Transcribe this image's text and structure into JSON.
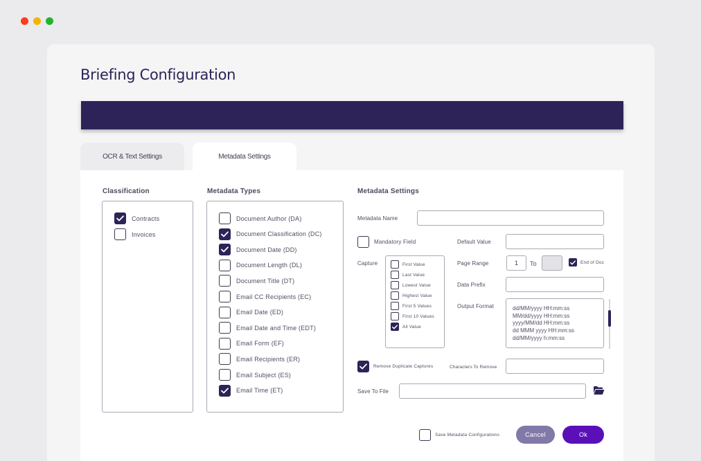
{
  "colors": {
    "accent": "#2e2358",
    "ok_button": "#5a0fb8",
    "cancel_button": "#8279a8",
    "dot_red": "#ff3b1f",
    "dot_yellow": "#f5b400",
    "dot_green": "#22b32c"
  },
  "page": {
    "title": "Briefing Configuration"
  },
  "tabs": [
    {
      "label": "OCR & Text Settings",
      "active": false
    },
    {
      "label": "Metadata Settings",
      "active": true
    }
  ],
  "classification": {
    "title": "Classification",
    "items": [
      {
        "label": "Contracts",
        "checked": true
      },
      {
        "label": "Invoices",
        "checked": false
      }
    ]
  },
  "metadata_types": {
    "title": "Metadata Types",
    "items": [
      {
        "label": "Document Author (DA)",
        "checked": false
      },
      {
        "label": "Document Classification (DC)",
        "checked": true
      },
      {
        "label": "Document Date (DD)",
        "checked": true
      },
      {
        "label": "Document Length (DL)",
        "checked": false
      },
      {
        "label": "Document Title (DT)",
        "checked": false
      },
      {
        "label": "Email CC Recipients (EC)",
        "checked": false
      },
      {
        "label": "Email Date (ED)",
        "checked": false
      },
      {
        "label": "Email Date and Time (EDT)",
        "checked": false
      },
      {
        "label": "Email Form (EF)",
        "checked": false
      },
      {
        "label": "Email Recipients (ER)",
        "checked": false
      },
      {
        "label": "Email Subject (ES)",
        "checked": false
      },
      {
        "label": "Email Time (ET)",
        "checked": true
      }
    ]
  },
  "metadata_settings": {
    "title": "Metadata Settings",
    "name_label": "Metadata Name",
    "name_value": "",
    "mandatory_label": "Mandatory Field",
    "mandatory_checked": false,
    "default_value_label": "Default Value",
    "default_value": "",
    "capture_label": "Capture",
    "capture_options": [
      {
        "label": "First Value",
        "checked": false
      },
      {
        "label": "Last Value",
        "checked": false
      },
      {
        "label": "Lowest Value",
        "checked": false
      },
      {
        "label": "Highest Value",
        "checked": false
      },
      {
        "label": "First 5 Values",
        "checked": false
      },
      {
        "label": "First 10 Values",
        "checked": false
      },
      {
        "label": "All Value",
        "checked": true
      }
    ],
    "page_range_label": "Page Range",
    "page_range_from": "1",
    "page_range_to_label": "To",
    "page_range_to": "",
    "end_of_doc_label": "End of Doc",
    "end_of_doc_checked": true,
    "data_prefix_label": "Data Prefix",
    "data_prefix": "",
    "output_format_label": "Output Format",
    "output_formats": [
      "dd/MM/yyyy HH:mm:ss",
      "MM/dd/yyyy HH:mm:ss",
      "yyyy/MM/dd HH:mm:ss",
      "dd MMM yyyy HH:mm:ss",
      "dd/MM/yyyy h:mm:ss"
    ],
    "remove_duplicates_label": "Remove Duplicate Captures",
    "remove_duplicates_checked": true,
    "chars_to_remove_label": "Characters To Remove",
    "chars_to_remove": "",
    "save_to_file_label": "Save To File",
    "save_to_file": ""
  },
  "footer": {
    "save_config_label": "Save Metadata Configurations",
    "save_config_checked": false,
    "cancel_label": "Cancel",
    "ok_label": "Ok"
  }
}
